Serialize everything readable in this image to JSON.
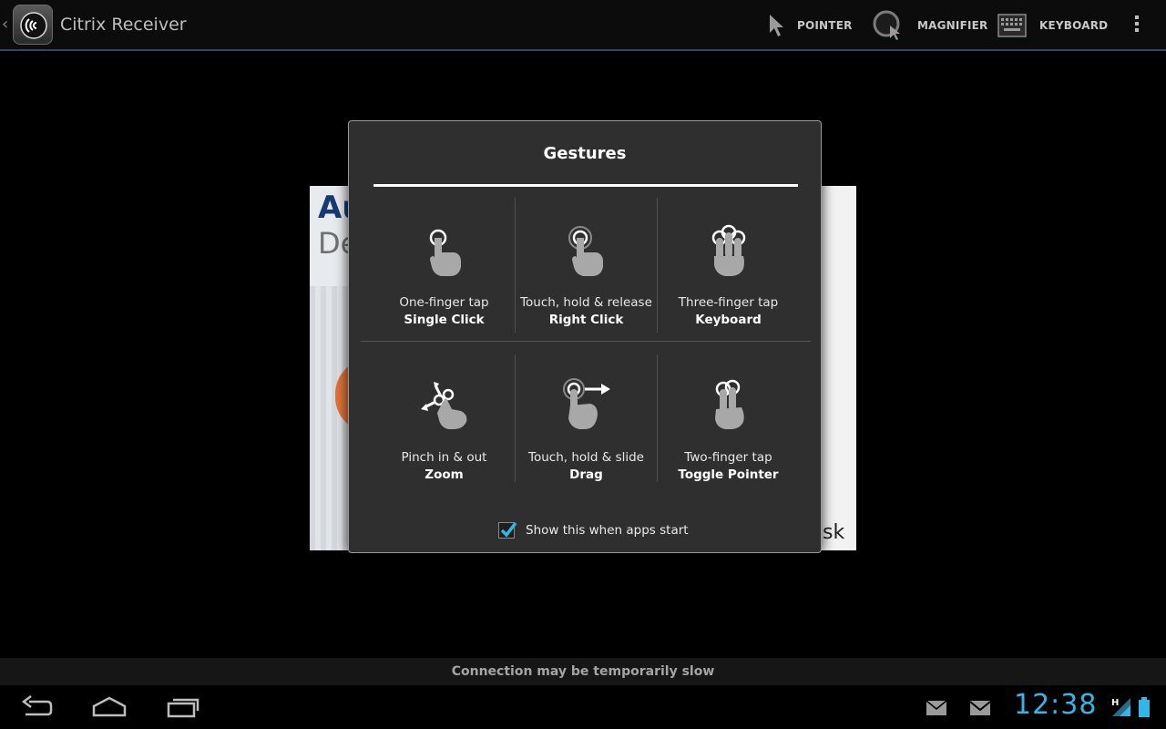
{
  "app": {
    "title": "Citrix Receiver"
  },
  "toolbar": {
    "actions": [
      {
        "label": "POINTER",
        "icon": "pointer-arrow-icon"
      },
      {
        "label": "MAGNIFIER",
        "icon": "magnifier-icon"
      },
      {
        "label": "KEYBOARD",
        "icon": "keyboard-icon"
      }
    ],
    "overflow_icon": "overflow-menu-icon"
  },
  "remote_content": {
    "text_top": "Au",
    "text_bottom": "De",
    "text_corner": "sk"
  },
  "dialog": {
    "title": "Gestures",
    "gestures": [
      {
        "description": "One-finger tap",
        "action": "Single Click",
        "icon": "one-finger-tap-icon"
      },
      {
        "description": "Touch, hold & release",
        "action": "Right Click",
        "icon": "touch-hold-release-icon"
      },
      {
        "description": "Three-finger tap",
        "action": "Keyboard",
        "icon": "three-finger-tap-icon"
      },
      {
        "description": "Pinch in & out",
        "action": "Zoom",
        "icon": "pinch-icon"
      },
      {
        "description": "Touch, hold & slide",
        "action": "Drag",
        "icon": "touch-hold-slide-icon"
      },
      {
        "description": "Two-finger tap",
        "action": "Toggle Pointer",
        "icon": "two-finger-tap-icon"
      }
    ],
    "show_on_start": {
      "label": "Show this when apps start",
      "checked": true
    }
  },
  "status": {
    "message": "Connection may be temporarily slow"
  },
  "system_bar": {
    "clock": "12:38",
    "network_type": "H",
    "accent_color": "#33b5e5"
  }
}
